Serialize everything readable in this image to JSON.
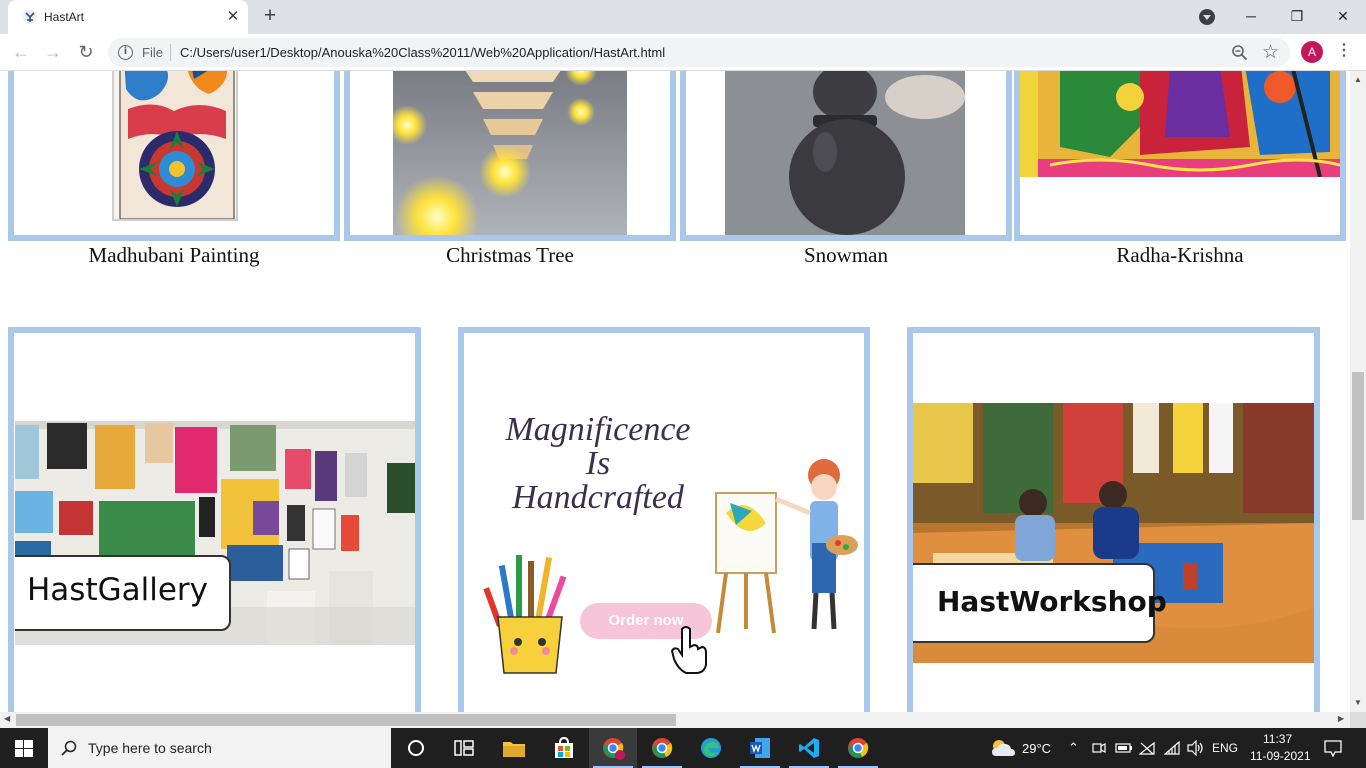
{
  "browser": {
    "tab_title": "HastArt",
    "tab_close": "✕",
    "new_tab": "+",
    "file_label": "File",
    "url": "C:/Users/user1/Desktop/Anouska%20Class%2011/Web%20Application/HastArt.html",
    "profile_initial": "A",
    "window_controls": {
      "minimize": "─",
      "maximize": "❐",
      "close": "✕"
    },
    "back": "←",
    "forward": "→",
    "reload": "↻",
    "star": "☆",
    "menu": "⋮"
  },
  "products": [
    {
      "caption": "Madhubani Painting",
      "icon": "madhubani-painting-image"
    },
    {
      "caption": "Christmas Tree",
      "icon": "christmas-tree-candles-image"
    },
    {
      "caption": "Snowman",
      "icon": "clay-snowman-image"
    },
    {
      "caption": "Radha-Krishna",
      "icon": "radha-krishna-painting-image"
    }
  ],
  "features": {
    "gallery": {
      "label": "HastGallery"
    },
    "order": {
      "line1": "Magnificence",
      "line2": "Is",
      "line3": "Handcrafted",
      "button": "Order now"
    },
    "workshop": {
      "label": "HastWorkshop"
    }
  },
  "taskbar": {
    "search_placeholder": "Type here to search",
    "temperature": "29°C",
    "language": "ENG",
    "time": "11:37",
    "date": "11-09-2021"
  },
  "colors": {
    "card_border": "#a9c8ea",
    "taskbar": "#1f1f1f",
    "profile": "#c2185b"
  }
}
